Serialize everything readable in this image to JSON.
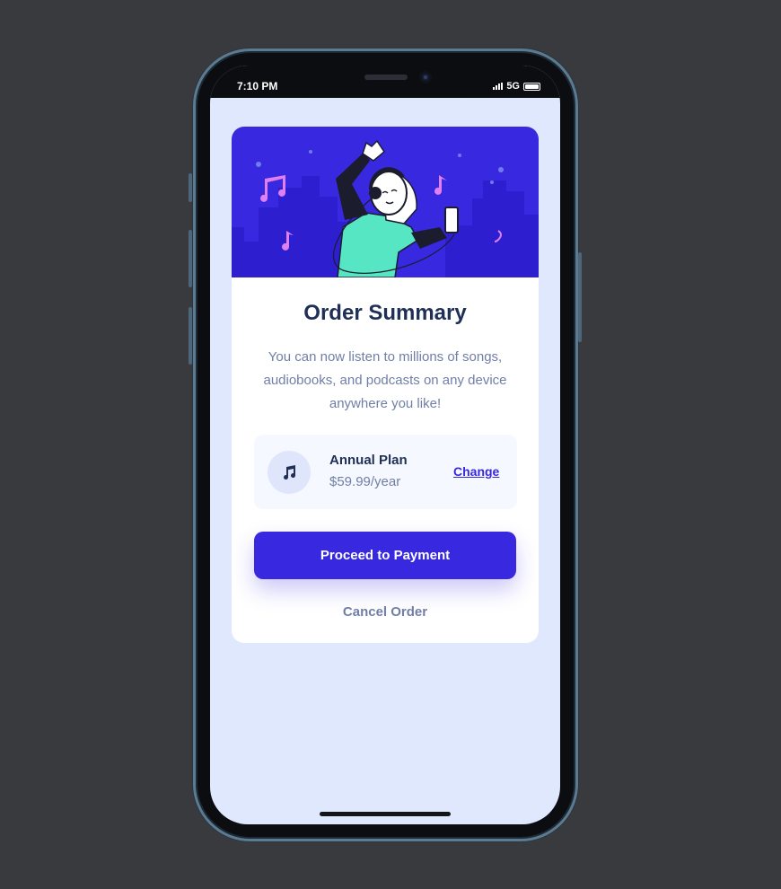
{
  "status_bar": {
    "time": "7:10 PM",
    "network": "5G",
    "icons": [
      "signal-icon",
      "battery-icon"
    ]
  },
  "card": {
    "hero_icon": "dancing-person-illustration",
    "title": "Order Summary",
    "description": "You can now listen to millions of songs, audiobooks, and podcasts on any device anywhere you like!",
    "plan": {
      "icon": "music-note-icon",
      "name": "Annual Plan",
      "price": "$59.99/year",
      "change_label": "Change"
    },
    "proceed_label": "Proceed to Payment",
    "cancel_label": "Cancel Order"
  },
  "colors": {
    "background": "#393a3e",
    "screen": "#e0e8fe",
    "accent": "#3829e0",
    "title": "#1f2f56",
    "muted": "#717fa6",
    "plan_bg": "#f5f8ff"
  }
}
